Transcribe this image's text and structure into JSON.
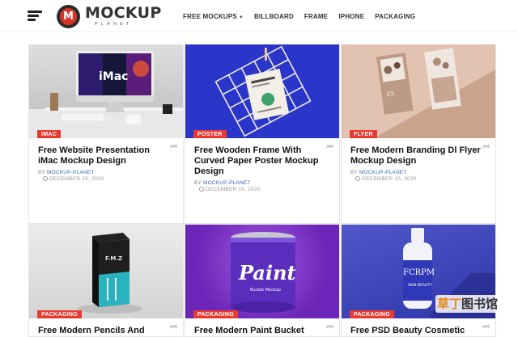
{
  "header": {
    "logo_letter": "M",
    "logo_main": "MOCKUP",
    "logo_sub": "PLANET",
    "nav": [
      {
        "label": "FREE MOCKUPS"
      },
      {
        "label": "BILLBOARD"
      },
      {
        "label": "FRAME"
      },
      {
        "label": "IPHONE"
      },
      {
        "label": "PACKAGING"
      }
    ]
  },
  "posts": [
    {
      "category": "IMAC",
      "title": "Free Website Presentation iMac Mockup Design",
      "by": "BY",
      "author": "MOCKUP-PLANET",
      "date": "DECEMBER 15, 2020",
      "screen_text": "iMac"
    },
    {
      "category": "POSTER",
      "title": "Free Wooden Frame With Curved Paper Poster Mockup Design",
      "by": "BY",
      "author": "MOCKUP-PLANET",
      "date": "DECEMBER 15, 2020"
    },
    {
      "category": "FLYER",
      "title": "Free Modern Branding Dl Flyer Mockup Design",
      "by": "BY",
      "author": "MOCKUP-PLANET",
      "date": "DECEMBER 15, 2020"
    },
    {
      "category": "PACKAGING",
      "title": "Free Modern Pencils And",
      "box_text": "F.M.Z"
    },
    {
      "category": "PACKAGING",
      "title": "Free Modern Paint Bucket",
      "can_text": "Paint",
      "can_sub": "Bucket Mockup"
    },
    {
      "category": "PACKAGING",
      "title": "Free PSD Beauty Cosmetic",
      "bottle_text": "FCRPM",
      "bottle_sub": "SKIN BEAUTY"
    }
  ],
  "watermark": {
    "highlight": "草丁",
    "rest": "图书馆"
  },
  "colors": {
    "accent": "#e93a32",
    "author_link": "#3a6ab4"
  }
}
